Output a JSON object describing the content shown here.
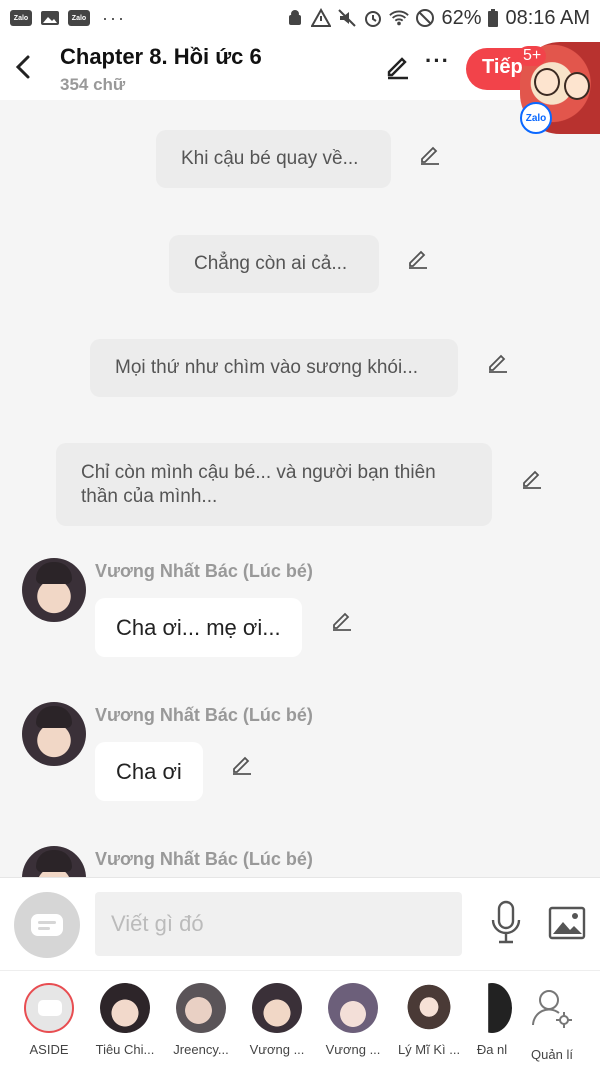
{
  "status_bar": {
    "battery": "62%",
    "time": "08:16 AM",
    "notif_app_1": "Zalo",
    "notif_app_2": "Zalo"
  },
  "header": {
    "title": "Chapter 8. Hồi ức 6",
    "word_count": "354 chữ",
    "next_label": "Tiếp",
    "badge": "5+",
    "zalo_label": "Zalo"
  },
  "messages": {
    "asides": [
      "Khi cậu bé quay về...",
      "Chẳng còn ai cả...",
      "Mọi thứ như chìm vào sương khói...",
      "Chỉ còn mình cậu bé... và người bạn thiên thần của mình..."
    ],
    "dialogues": [
      {
        "name": "Vương Nhất Bác (Lúc bé)",
        "text": "Cha ơi... mẹ ơi..."
      },
      {
        "name": "Vương Nhất Bác (Lúc bé)",
        "text": "Cha ơi"
      },
      {
        "name": "Vương Nhất Bác (Lúc bé)",
        "text": ""
      }
    ]
  },
  "input": {
    "placeholder": "Viết gì đó"
  },
  "characters": [
    {
      "label": "ASIDE"
    },
    {
      "label": "Tiêu Chi..."
    },
    {
      "label": "Jreency..."
    },
    {
      "label": "Vương ..."
    },
    {
      "label": "Vương ..."
    },
    {
      "label": "Lý Mĩ Kì ..."
    },
    {
      "label": "Đa nl"
    },
    {
      "label": "Quản lí"
    }
  ],
  "colors": {
    "accent": "#f2434a",
    "background": "#f5f5f5",
    "aside_bubble": "#ececec"
  }
}
